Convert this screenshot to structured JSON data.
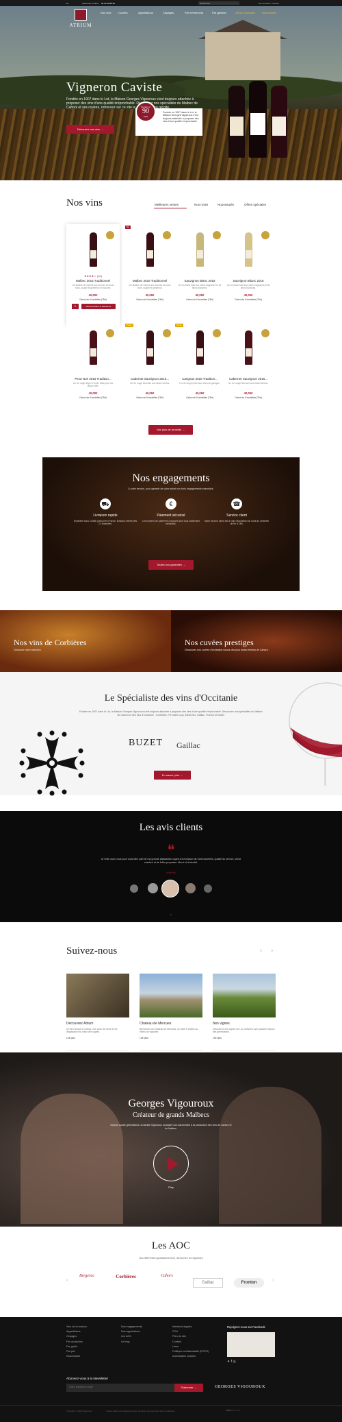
{
  "topbar": {
    "left1": "FR",
    "service": "SERVICE CLIENT",
    "phone": "05 63 49 89 00",
    "search_placeholder": "Rechercher",
    "account": "Se connecter / Inscrire"
  },
  "nav": {
    "left": [
      "Nos vins",
      "Cuvées",
      "Appellations",
      "Cépages"
    ],
    "right": [
      "Par événement",
      "Par gamme",
      "Offres Spéciales",
      "Nouveautés"
    ]
  },
  "logo": "ATRIUM",
  "hero": {
    "title": "Vigneron Caviste",
    "text": "Fondée en 1907 dans le Lot, la Maison Georges Vigouroux s'est toujours attachée à proposer des vins d'une qualité irréprochable. Découvrez nos spécialités du Malbec de Cahors et ses cuvées, retrouvez sur ce site le meilleur de sa récolte.",
    "button": "Découvrir nos vins",
    "medal_top": "Fondée en",
    "medal_num": "90",
    "medal_bottom": "ANS",
    "badge_text": "Fondée en 1907 dans le Lot, la Maison Georges Vigouroux s'est toujours attachée à proposer des vins d'une qualité irréprochable."
  },
  "colors": {
    "accent": "#a3182c",
    "dark": "#121212",
    "wine": "#8d1a2b"
  },
  "vins": {
    "title": "Nos vins",
    "tabs": [
      "Meilleures ventes",
      "Nos rosés",
      "Nouveautés",
      "Offres spéciales"
    ],
    "products": [
      {
        "name": "Malbec 2016 Traditionnel",
        "desc": "Un Malbec de Cahors aux arômes de fruits noirs, souple et généreux en bouche.",
        "price": "42,00€",
        "stock": "Carton de 6 bouteilles (75cl)",
        "tag": "",
        "color": "#3a0f14",
        "rating": "★★★★☆",
        "reviews": "(10)",
        "cta": "DÉCOUVRIR LE PRODUIT"
      },
      {
        "name": "Malbec 2016 Traditionnel",
        "desc": "Un Malbec de Cahors aux arômes de fruits noirs, souple et généreux.",
        "price": "42,00€",
        "stock": "Carton de 6 bouteilles (75cl)",
        "tag": "Bio",
        "color": "#3a0f14"
      },
      {
        "name": "Sauvignon Blanc 2018",
        "desc": "Un vin blanc frais aux notes d'agrumes et de fleurs blanches.",
        "price": "42,00€",
        "stock": "Carton de 6 bouteilles (75cl)",
        "tag": "",
        "color": "#c8b77a"
      },
      {
        "name": "Sauvignon Blanc 2018",
        "desc": "Un vin blanc frais aux notes d'agrumes et de fleurs blanches.",
        "price": "42,00€",
        "stock": "Carton de 6 bouteilles (75cl)",
        "tag": "",
        "color": "#d4c48a"
      },
      {
        "name": "Pinot Noir 2016 Tradition...",
        "desc": "Un vin rouge léger et fruité, idéal pour les repas d'été.",
        "price": "42,00€",
        "stock": "Carton de 6 bouteilles (75cl)",
        "tag": "",
        "color": "#4a1218"
      },
      {
        "name": "Cabernet Sauvignon 2016...",
        "desc": "Un vin rouge structuré aux tanins fondus.",
        "price": "42,00€",
        "stock": "Carton de 6 bouteilles (75cl)",
        "tag": "Promo",
        "color": "#3a0f14"
      },
      {
        "name": "Carignan 2016 Tradition...",
        "desc": "Un vin rouge épicé aux notes de garrigue.",
        "price": "42,00€",
        "stock": "Carton de 6 bouteilles (75cl)",
        "tag": "Promo",
        "color": "#3a0f14"
      },
      {
        "name": "Cabernet Sauvignon 2016...",
        "desc": "Un vin rouge structuré aux tanins fondus.",
        "price": "42,00€",
        "stock": "Carton de 6 bouteilles (75cl)",
        "tag": "",
        "color": "#4a1218"
      }
    ],
    "more_button": "Voir plus de produits"
  },
  "engagements": {
    "title": "Nos engagements",
    "subtitle": "À votre service, pour garantir de votre achat nos trois engagements essentiels.",
    "items": [
      {
        "icon": "truck-icon",
        "title": "Livraison rapide",
        "desc": "Expédiée sous 24/48h partout en France, livraison offerte dès 12 bouteilles."
      },
      {
        "icon": "euro-icon",
        "title": "Paiement sécurisé",
        "desc": "Les moyens de paiement proposés sont tous totalement sécurisés."
      },
      {
        "icon": "headset-icon",
        "title": "Service client",
        "desc": "Notre service client est à votre disposition du lundi au vendredi de 9h à 18h."
      }
    ],
    "button": "Toutes nos garanties"
  },
  "banners": [
    {
      "title": "Nos vins de Corbières",
      "subtitle": "Découvrir notre sélection"
    },
    {
      "title": "Nos cuvées prestiges",
      "subtitle": "Découvrez nos cuvées d'exception issues des plus beaux terroirs de Cahors."
    }
  ],
  "specialiste": {
    "title": "Le Spécialiste des vins d'Occitanie",
    "text": "Fondée en 1907 dans le Lot, la Maison Georges Vigouroux s'est toujours attachée à proposer des vins d'une qualité irréprochable. Découvrez nos spécialités du Malbec de Cahors et des vins d'Occitanie : Corbières, Pic Saint Loup, Minervois, Gaillac, Fronton et Buzet.",
    "logos": [
      "BUZET",
      "Gaillac"
    ],
    "button": "En savoir plus"
  },
  "avis": {
    "title": "Les avis clients",
    "quote": "Je reste avec vous pour vous faire part de ma grande satisfaction quant à la livraison de mes bouteilles, qualité du service, vente réactive et de l'offre proposée. Merci et à bientôt.",
    "author": "Mathilde"
  },
  "social": {
    "title": "Suivez-nous",
    "posts": [
      {
        "title": "Découvrez Atrium",
        "desc": "Un lieu unique à Cahors, une cave de vente et de dégustation au cœur des vignes.",
        "link": "Lire plus",
        "comments": "0",
        "likes": "0",
        "share": "PARTAGER"
      },
      {
        "title": "Chateau de Mercues",
        "desc": "Bienvenue au Château de Mercuès, un hôtel 5 étoiles au milieu du vignoble.",
        "link": "Lire plus",
        "comments": "0",
        "likes": "0",
        "share": "PARTAGER"
      },
      {
        "title": "Nos vignes",
        "desc": "Découvrez nos vignes du Lot, cultivées avec passion depuis des générations.",
        "link": "Lire plus",
        "comments": "0",
        "likes": "0",
        "share": "PARTAGER"
      }
    ]
  },
  "georges": {
    "title": "Georges Vigouroux",
    "subtitle": "Créateur de grands Malbecs",
    "text": "Depuis quatre générations, la famille Vigouroux consacre son savoir-faire à la production des vins de Cahors et du Malbec.",
    "play": "Play"
  },
  "aoc": {
    "title": "Les AOC",
    "subtitle": "Nos différentes appellations AOC, découvrez les vignobles",
    "logos": [
      "Bergerac",
      "Corbières",
      "Cahors",
      "Gaillac",
      "Fronton"
    ]
  },
  "footer": {
    "col1": [
      "Vins de la maison",
      "Appellations",
      "Cépages",
      "Par occasions",
      "Par goûts",
      "Par prix",
      "Nouveautés"
    ],
    "col2": [
      "Nos engagements",
      "Nos appellations",
      "Les AOC",
      "Le blog"
    ],
    "col3": [
      "Mentions légales",
      "CGV",
      "Plan du site",
      "Contact",
      "Liens",
      "Politique confidentialité (RGPD)",
      "Autorisation cookies"
    ],
    "facebook_title": "Rejoignez-nous sur Facebook",
    "newsletter_title": "Abonnez-vous à la Newsletter",
    "newsletter_placeholder": "Votre adresse e-mail",
    "newsletter_button": "S'abonner",
    "brand": "GEORGES VIGOUROUX",
    "copyright": "Copyright © 2020 Vigouroux",
    "legal": "L'abus d'alcool est dangereux pour la santé, à consommer avec modération."
  }
}
